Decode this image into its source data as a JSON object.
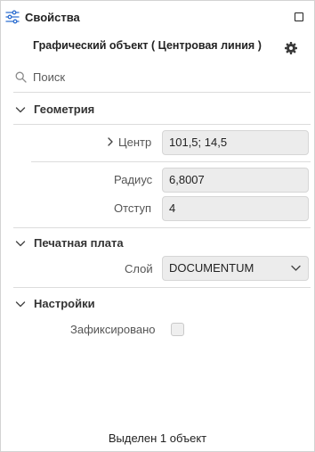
{
  "header": {
    "title": "Свойства",
    "icon": "sliders-icon",
    "maximize_icon": "square-icon"
  },
  "object_title": "Графический объект ( Центровая линия )",
  "search": {
    "placeholder": "Поиск",
    "value": ""
  },
  "sections": {
    "geometry": {
      "label": "Геометрия",
      "center": {
        "label": "Центр",
        "value": "101,5; 14,5"
      },
      "radius": {
        "label": "Радиус",
        "value": "6,8007"
      },
      "offset": {
        "label": "Отступ",
        "value": "4"
      }
    },
    "pcb": {
      "label": "Печатная плата",
      "layer": {
        "label": "Слой",
        "value": "DOCUMENTUM"
      }
    },
    "settings": {
      "label": "Настройки",
      "fixed": {
        "label": "Зафиксировано",
        "checked": false
      }
    }
  },
  "status": "Выделен 1 объект",
  "colors": {
    "field_bg": "#ececec",
    "border": "#d6d6d6",
    "divider": "#dcdcdc",
    "text": "#222222"
  }
}
